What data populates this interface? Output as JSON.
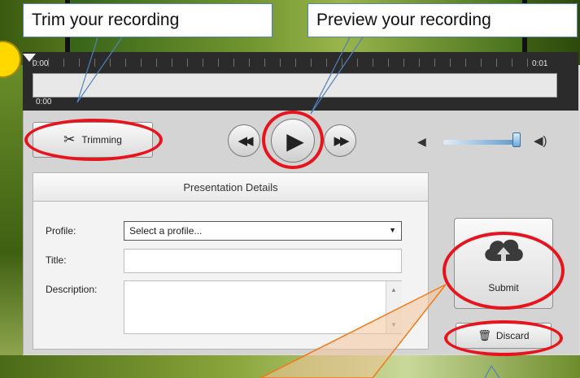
{
  "callouts": {
    "trim": "Trim your recording",
    "preview": "Preview your recording"
  },
  "timeline": {
    "start_top": "0:00",
    "start_bottom": "0:00",
    "end": "0:01"
  },
  "controls": {
    "trimming_label": "Trimming"
  },
  "details": {
    "header": "Presentation Details",
    "profile_label": "Profile:",
    "profile_value": "Select a profile...",
    "title_label": "Title:",
    "title_value": "",
    "description_label": "Description:",
    "description_value": ""
  },
  "actions": {
    "submit_label": "Submit",
    "discard_label": "Discard"
  },
  "colors": {
    "annotation_red": "#e8141d",
    "callout_border": "#4f81bd",
    "arrow_orange": "#f07a1a"
  }
}
